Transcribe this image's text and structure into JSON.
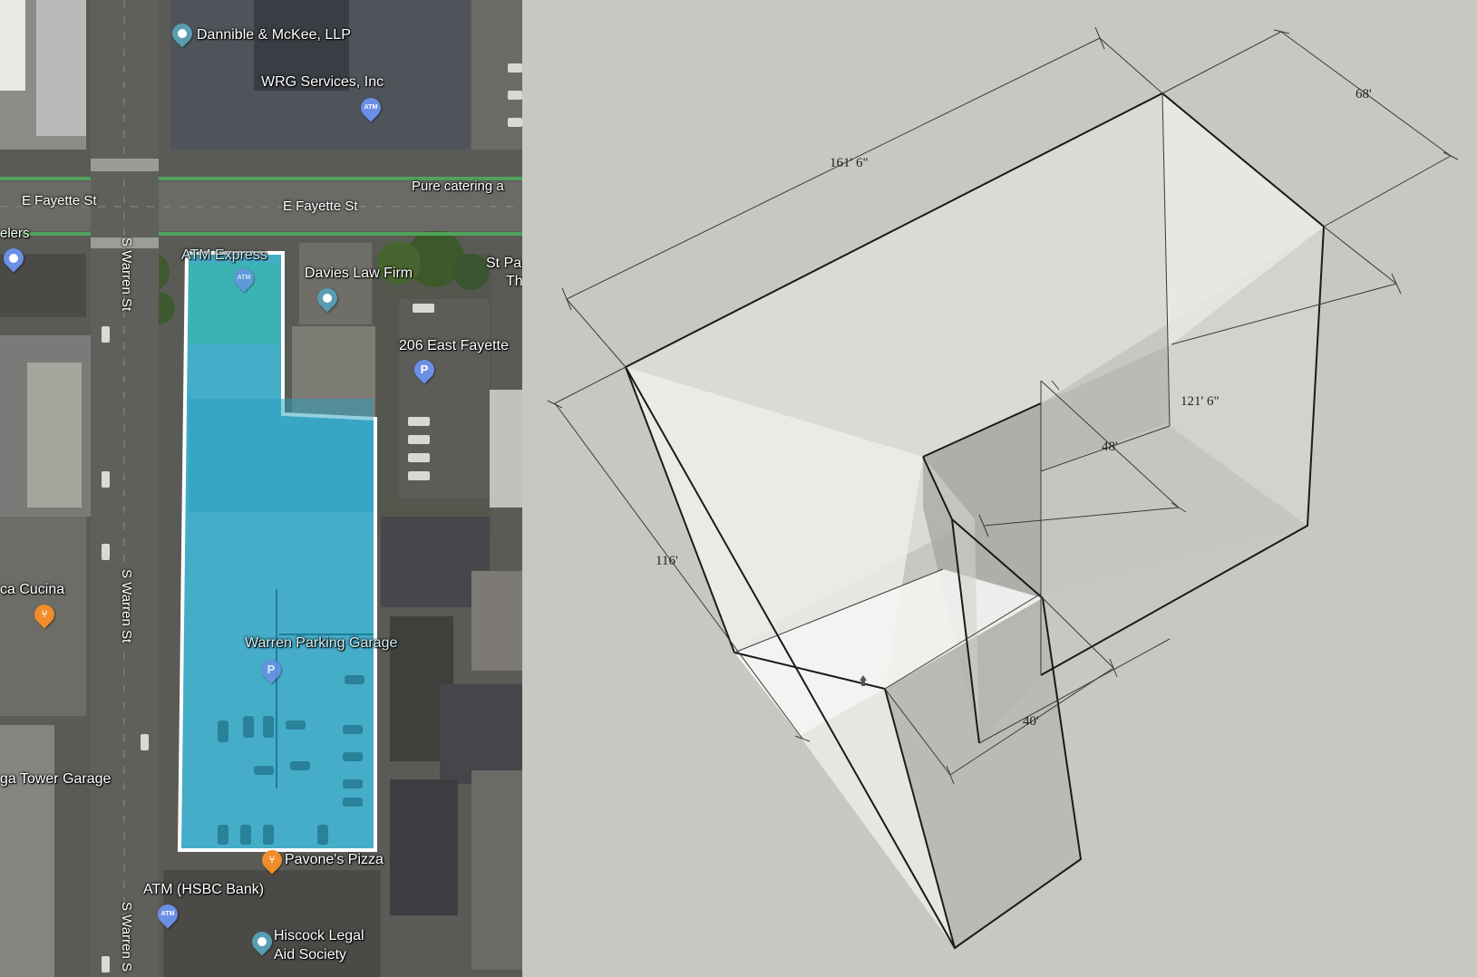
{
  "map": {
    "streets": {
      "fayette_left": "E Fayette St",
      "fayette_main": "E Fayette St",
      "warren_1": "S Warren St",
      "warren_2": "S Warren St",
      "warren_3": "S Warren S"
    },
    "places": {
      "dannible": "Dannible & McKee, LLP",
      "wrg": "WRG Services, Inc",
      "pure_catering": "Pure catering a",
      "jewelers": "elers",
      "atm_express": "ATM Express",
      "davies": "Davies Law Firm",
      "st_paul": "St Pa",
      "st_paul_2": "Th",
      "east_fayette_206": "206 East Fayette",
      "cucina": "ca Cucina",
      "warren_garage": "Warren Parking Garage",
      "tower_garage": "ga Tower Garage",
      "pavones": "Pavone's Pizza",
      "atm_hsbc": "ATM (HSBC Bank)",
      "hiscock_1": "Hiscock Legal",
      "hiscock_2": "Aid Society"
    },
    "icons": {
      "atm": "ATM",
      "parking": "P"
    },
    "colors": {
      "parcel_fill": "#3fc4e8",
      "parcel_outline": "#ffffff",
      "pin_teal": "#5a9db2",
      "pin_blue": "#6c8fe6",
      "pin_orange": "#f08c2a"
    }
  },
  "model": {
    "dimensions": {
      "length": "161' 6\"",
      "width": "68'",
      "depth_right": "121' 6\"",
      "notch_width": "48'",
      "side": "116'",
      "notch_depth": "40'"
    }
  }
}
